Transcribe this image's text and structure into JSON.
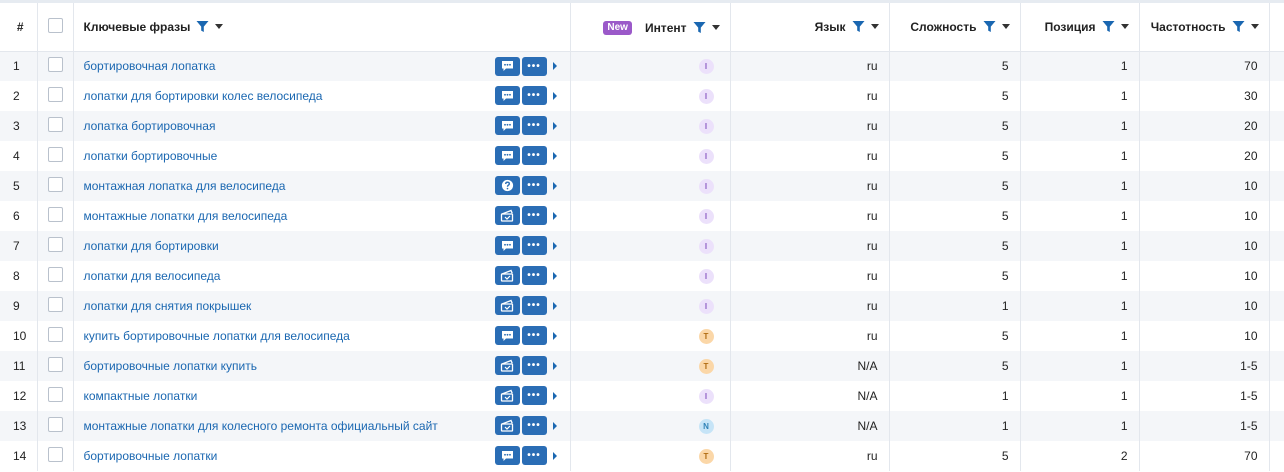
{
  "columns": {
    "num": "#",
    "keywords": "Ключевые фразы",
    "intent": "Интент",
    "intent_new_badge": "New",
    "language": "Язык",
    "difficulty": "Сложность",
    "position": "Позиция",
    "frequency": "Частотность"
  },
  "colors": {
    "link": "#1a67b1",
    "button": "#2a6db5",
    "intent_I": "#ece1fb",
    "intent_T": "#fbd7a8",
    "intent_N": "#c6e4f7",
    "new_badge": "#9b59c9"
  },
  "rows": [
    {
      "num": "1",
      "keyword": "бортировочная лопатка",
      "serp_icon": "chat-icon",
      "intent": "I",
      "language": "ru",
      "difficulty": "5",
      "position": "1",
      "frequency": "70"
    },
    {
      "num": "2",
      "keyword": "лопатки для бортировки колес велосипеда",
      "serp_icon": "chat-icon",
      "intent": "I",
      "language": "ru",
      "difficulty": "5",
      "position": "1",
      "frequency": "30"
    },
    {
      "num": "3",
      "keyword": "лопатка бортировочная",
      "serp_icon": "chat-icon",
      "intent": "I",
      "language": "ru",
      "difficulty": "5",
      "position": "1",
      "frequency": "20"
    },
    {
      "num": "4",
      "keyword": "лопатки бортировочные",
      "serp_icon": "chat-icon",
      "intent": "I",
      "language": "ru",
      "difficulty": "5",
      "position": "1",
      "frequency": "20"
    },
    {
      "num": "5",
      "keyword": "монтажная лопатка для велосипеда",
      "serp_icon": "question-icon",
      "intent": "I",
      "language": "ru",
      "difficulty": "5",
      "position": "1",
      "frequency": "10"
    },
    {
      "num": "6",
      "keyword": "монтажные лопатки для велосипеда",
      "serp_icon": "shopping-icon",
      "intent": "I",
      "language": "ru",
      "difficulty": "5",
      "position": "1",
      "frequency": "10"
    },
    {
      "num": "7",
      "keyword": "лопатки для бортировки",
      "serp_icon": "chat-icon",
      "intent": "I",
      "language": "ru",
      "difficulty": "5",
      "position": "1",
      "frequency": "10"
    },
    {
      "num": "8",
      "keyword": "лопатки для велосипеда",
      "serp_icon": "shopping-icon",
      "intent": "I",
      "language": "ru",
      "difficulty": "5",
      "position": "1",
      "frequency": "10"
    },
    {
      "num": "9",
      "keyword": "лопатки для снятия покрышек",
      "serp_icon": "shopping-icon",
      "intent": "I",
      "language": "ru",
      "difficulty": "1",
      "position": "1",
      "frequency": "10"
    },
    {
      "num": "10",
      "keyword": "купить бортировочные лопатки для велосипеда",
      "serp_icon": "chat-icon",
      "intent": "T",
      "language": "ru",
      "difficulty": "5",
      "position": "1",
      "frequency": "10"
    },
    {
      "num": "11",
      "keyword": "бортировочные лопатки купить",
      "serp_icon": "shopping-icon",
      "intent": "T",
      "language": "N/A",
      "difficulty": "5",
      "position": "1",
      "frequency": "1-5"
    },
    {
      "num": "12",
      "keyword": "компактные лопатки",
      "serp_icon": "shopping-icon",
      "intent": "I",
      "language": "N/A",
      "difficulty": "1",
      "position": "1",
      "frequency": "1-5"
    },
    {
      "num": "13",
      "keyword": "монтажные лопатки для колесного ремонта официальный сайт",
      "serp_icon": "shopping-icon",
      "intent": "N",
      "language": "N/A",
      "difficulty": "1",
      "position": "1",
      "frequency": "1-5"
    },
    {
      "num": "14",
      "keyword": "бортировочные лопатки",
      "serp_icon": "chat-icon",
      "intent": "T",
      "language": "ru",
      "difficulty": "5",
      "position": "2",
      "frequency": "70"
    }
  ]
}
